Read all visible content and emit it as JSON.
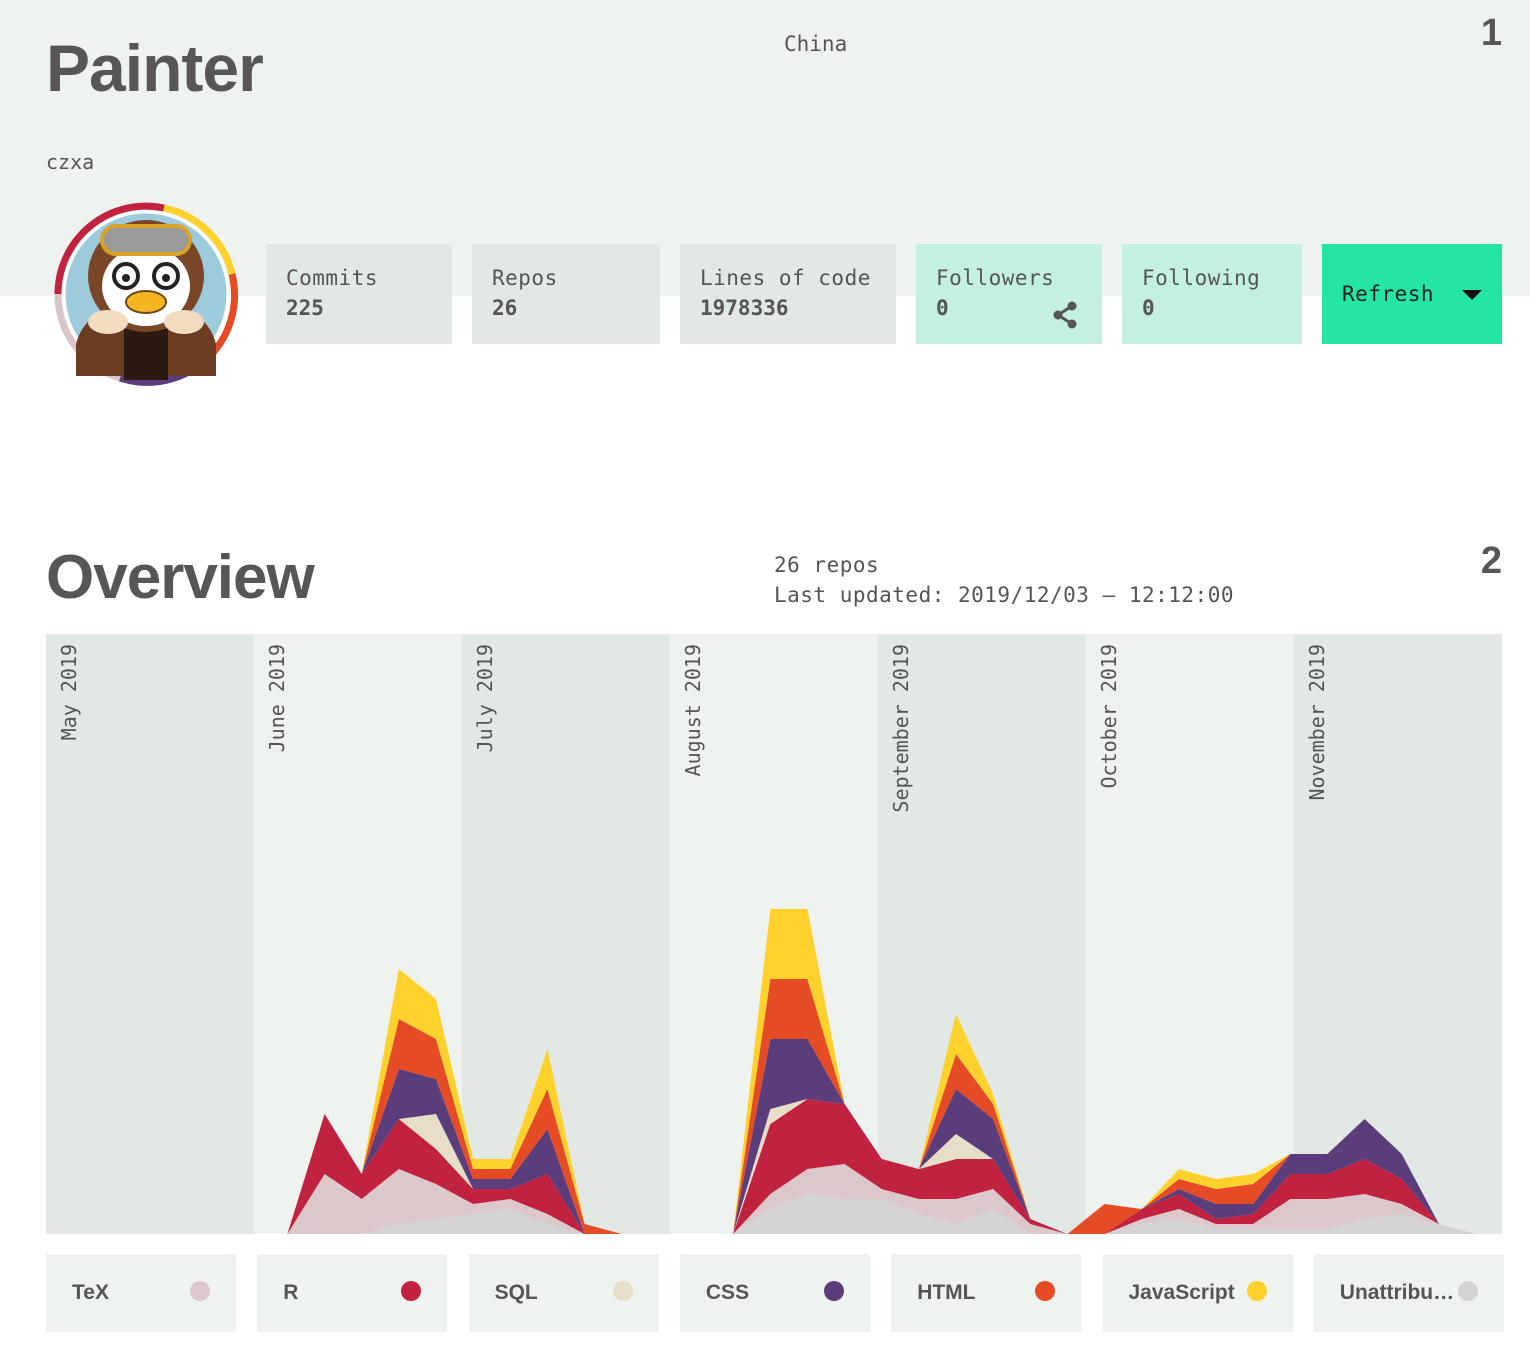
{
  "profile": {
    "name": "Painter",
    "location": "China",
    "username": "czxa",
    "section_number": "1",
    "avatar_ring": [
      "#c0223f",
      "#fed12d",
      "#e54c26",
      "#5a3d7a",
      "#d9c5c9"
    ]
  },
  "stats": [
    {
      "label": "Commits",
      "value": "225"
    },
    {
      "label": "Repos",
      "value": "26"
    },
    {
      "label": "Lines of code",
      "value": "1978336"
    },
    {
      "label": "Followers",
      "value": "0",
      "icon": "share-icon"
    },
    {
      "label": "Following",
      "value": "0"
    }
  ],
  "refresh": {
    "label": "Refresh",
    "icon": "caret-down-icon"
  },
  "overview": {
    "title": "Overview",
    "section_number": "2",
    "repos_text": "26 repos",
    "updated_text": "Last updated: 2019/12/03 – 12:12:00"
  },
  "chart_data": {
    "type": "area",
    "stacked": true,
    "months": [
      "May 2019",
      "June 2019",
      "July 2019",
      "August 2019",
      "September 2019",
      "October 2019",
      "November 2019"
    ],
    "band_colors": [
      "#e2e8e4",
      "#eff3f0"
    ],
    "series": [
      {
        "name": "Unattributed",
        "color": "#d3d3d3",
        "values": [
          0,
          0,
          0,
          0,
          0,
          0,
          10,
          15,
          20,
          25,
          10,
          0,
          0,
          0,
          0,
          0,
          25,
          40,
          35,
          35,
          20,
          10,
          25,
          0,
          0,
          0,
          10,
          15,
          5,
          5,
          5,
          5,
          15,
          20,
          10,
          0
        ]
      },
      {
        "name": "TeX",
        "color": "#dcc7ca",
        "values": [
          0,
          0,
          0,
          0,
          60,
          35,
          55,
          35,
          10,
          10,
          10,
          0,
          0,
          0,
          0,
          0,
          15,
          25,
          35,
          10,
          15,
          25,
          20,
          10,
          0,
          0,
          5,
          10,
          5,
          5,
          30,
          30,
          25,
          10,
          0
        ]
      },
      {
        "name": "R",
        "color": "#c0223f",
        "values": [
          0,
          0,
          0,
          0,
          60,
          25,
          50,
          35,
          15,
          10,
          40,
          0,
          0,
          0,
          0,
          0,
          70,
          70,
          60,
          30,
          30,
          40,
          30,
          5,
          0,
          0,
          10,
          15,
          5,
          10,
          25,
          25,
          35,
          25,
          0
        ]
      },
      {
        "name": "SQL",
        "color": "#e6dec8",
        "values": [
          0,
          0,
          0,
          0,
          0,
          0,
          0,
          35,
          0,
          0,
          0,
          0,
          0,
          0,
          0,
          0,
          15,
          0,
          0,
          0,
          0,
          25,
          0,
          0,
          0,
          0,
          0,
          0,
          0,
          0,
          0,
          0,
          0,
          0,
          0
        ]
      },
      {
        "name": "CSS",
        "color": "#5a3d7a",
        "values": [
          0,
          0,
          0,
          0,
          0,
          0,
          50,
          35,
          10,
          10,
          45,
          0,
          0,
          0,
          0,
          0,
          70,
          60,
          0,
          0,
          0,
          45,
          40,
          0,
          0,
          0,
          0,
          5,
          15,
          10,
          20,
          20,
          40,
          25,
          0
        ]
      },
      {
        "name": "HTML",
        "color": "#e54c26",
        "values": [
          0,
          0,
          0,
          0,
          0,
          0,
          50,
          40,
          10,
          10,
          40,
          10,
          0,
          0,
          0,
          0,
          60,
          60,
          0,
          0,
          0,
          35,
          15,
          0,
          0,
          30,
          0,
          10,
          15,
          20,
          0,
          0,
          0,
          0,
          0
        ]
      },
      {
        "name": "JavaScript",
        "color": "#fed12d",
        "values": [
          0,
          0,
          0,
          0,
          0,
          0,
          50,
          40,
          10,
          10,
          40,
          0,
          0,
          0,
          0,
          0,
          70,
          70,
          0,
          0,
          0,
          40,
          10,
          0,
          0,
          0,
          0,
          10,
          10,
          10,
          0,
          0,
          0,
          0,
          0
        ]
      }
    ]
  },
  "legend": [
    {
      "name": "TeX",
      "color": "#dcc7ca"
    },
    {
      "name": "R",
      "color": "#c0223f"
    },
    {
      "name": "SQL",
      "color": "#e6dec8"
    },
    {
      "name": "CSS",
      "color": "#5a3d7a"
    },
    {
      "name": "HTML",
      "color": "#e54c26"
    },
    {
      "name": "JavaScript",
      "color": "#fed12d"
    },
    {
      "name": "Unattributed",
      "color": "#d3d3d3"
    }
  ]
}
